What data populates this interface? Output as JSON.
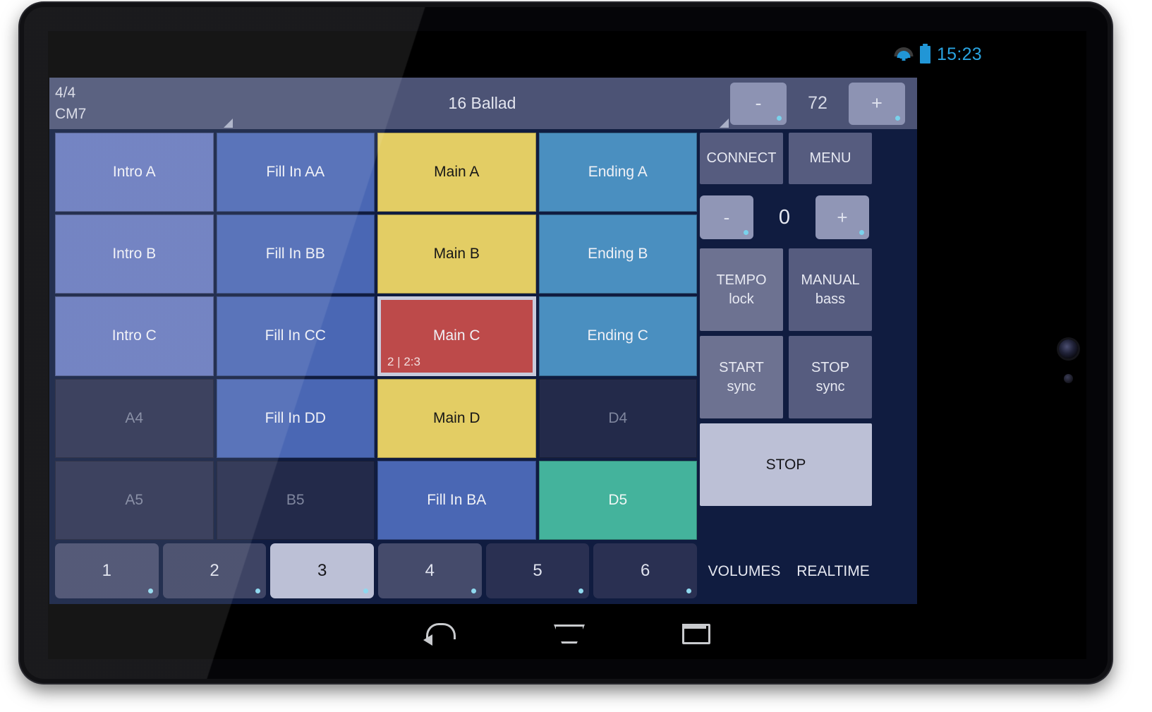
{
  "status_bar": {
    "wifi_icon": "wifi-icon",
    "battery_icon": "battery-icon",
    "time": "15:23"
  },
  "topbar": {
    "time_signature": "4/4",
    "chord": "CM7",
    "style_name": "16 Ballad",
    "tempo_minus": "-",
    "tempo_value": "72",
    "tempo_plus": "+"
  },
  "grid": {
    "rows": [
      [
        {
          "label": "Intro A",
          "style": "c-intro"
        },
        {
          "label": "Fill In AA",
          "style": "c-fill"
        },
        {
          "label": "Main A",
          "style": "c-main"
        },
        {
          "label": "Ending A",
          "style": "c-ending"
        }
      ],
      [
        {
          "label": "Intro B",
          "style": "c-intro"
        },
        {
          "label": "Fill In BB",
          "style": "c-fill"
        },
        {
          "label": "Main B",
          "style": "c-main"
        },
        {
          "label": "Ending B",
          "style": "c-ending"
        }
      ],
      [
        {
          "label": "Intro C",
          "style": "c-intro"
        },
        {
          "label": "Fill In CC",
          "style": "c-fill"
        },
        {
          "label": "Main C",
          "style": "c-active",
          "sub": "2 | 2:3"
        },
        {
          "label": "Ending C",
          "style": "c-ending"
        }
      ],
      [
        {
          "label": "A4",
          "style": "c-empty"
        },
        {
          "label": "Fill In DD",
          "style": "c-fill"
        },
        {
          "label": "Main D",
          "style": "c-main"
        },
        {
          "label": "D4",
          "style": "c-empty2"
        }
      ],
      [
        {
          "label": "A5",
          "style": "c-empty"
        },
        {
          "label": "B5",
          "style": "c-empty2"
        },
        {
          "label": "Fill In BA",
          "style": "c-fill"
        },
        {
          "label": "D5",
          "style": "c-teal"
        }
      ]
    ]
  },
  "side_panel": {
    "connect": "CONNECT",
    "menu": "MENU",
    "transpose_minus": "-",
    "transpose_value": "0",
    "transpose_plus": "+",
    "tempo_lock_line1": "TEMPO",
    "tempo_lock_line2": "lock",
    "manual_bass_line1": "MANUAL",
    "manual_bass_line2": "bass",
    "start_sync_line1": "START",
    "start_sync_line2": "sync",
    "stop_sync_line1": "STOP",
    "stop_sync_line2": "sync",
    "stop": "STOP",
    "volumes": "VOLUMES",
    "realtime": "REALTIME"
  },
  "variation_buttons": [
    {
      "label": "1",
      "style": "n-a",
      "selected": false
    },
    {
      "label": "2",
      "style": "n-b",
      "selected": false
    },
    {
      "label": "3",
      "style": "n-c",
      "selected": true
    },
    {
      "label": "4",
      "style": "n-a",
      "selected": false
    },
    {
      "label": "5",
      "style": "n-d",
      "selected": false
    },
    {
      "label": "6",
      "style": "n-d",
      "selected": false
    }
  ],
  "nav_bar": {
    "back": "back-icon",
    "home": "home-icon",
    "recents": "recents-icon"
  },
  "colors": {
    "app_background": "#101c40",
    "topbar": "#4c5375",
    "intro": "#6779bd",
    "fill": "#4a67b4",
    "main": "#e3cd64",
    "ending": "#4a8fc0",
    "active": "#bd4a4a",
    "teal": "#44b39c",
    "accent_dot": "#79d2ec",
    "status_accent": "#29a3e0"
  }
}
